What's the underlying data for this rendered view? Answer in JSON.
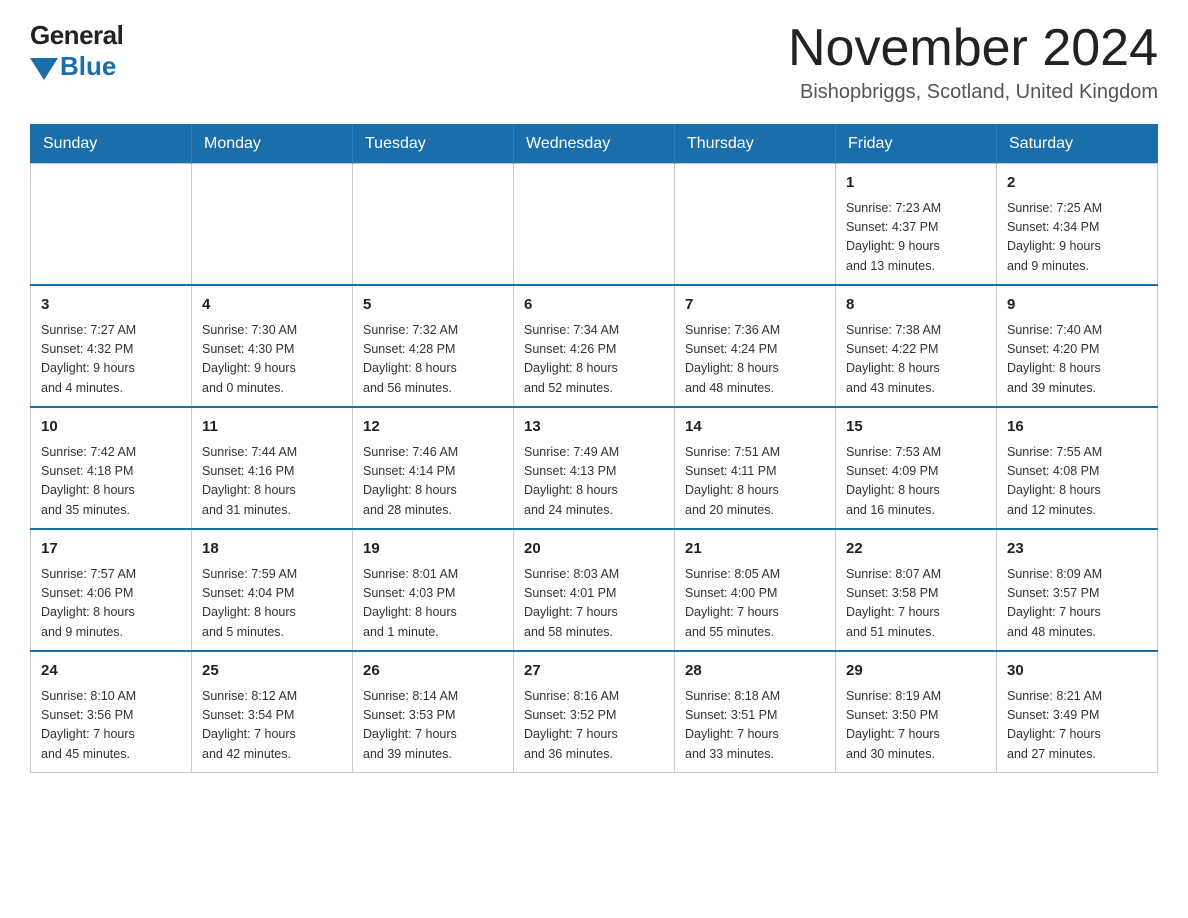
{
  "logo": {
    "general": "General",
    "blue": "Blue"
  },
  "title": "November 2024",
  "location": "Bishopbriggs, Scotland, United Kingdom",
  "weekdays": [
    "Sunday",
    "Monday",
    "Tuesday",
    "Wednesday",
    "Thursday",
    "Friday",
    "Saturday"
  ],
  "weeks": [
    [
      {
        "day": "",
        "info": ""
      },
      {
        "day": "",
        "info": ""
      },
      {
        "day": "",
        "info": ""
      },
      {
        "day": "",
        "info": ""
      },
      {
        "day": "",
        "info": ""
      },
      {
        "day": "1",
        "info": "Sunrise: 7:23 AM\nSunset: 4:37 PM\nDaylight: 9 hours\nand 13 minutes."
      },
      {
        "day": "2",
        "info": "Sunrise: 7:25 AM\nSunset: 4:34 PM\nDaylight: 9 hours\nand 9 minutes."
      }
    ],
    [
      {
        "day": "3",
        "info": "Sunrise: 7:27 AM\nSunset: 4:32 PM\nDaylight: 9 hours\nand 4 minutes."
      },
      {
        "day": "4",
        "info": "Sunrise: 7:30 AM\nSunset: 4:30 PM\nDaylight: 9 hours\nand 0 minutes."
      },
      {
        "day": "5",
        "info": "Sunrise: 7:32 AM\nSunset: 4:28 PM\nDaylight: 8 hours\nand 56 minutes."
      },
      {
        "day": "6",
        "info": "Sunrise: 7:34 AM\nSunset: 4:26 PM\nDaylight: 8 hours\nand 52 minutes."
      },
      {
        "day": "7",
        "info": "Sunrise: 7:36 AM\nSunset: 4:24 PM\nDaylight: 8 hours\nand 48 minutes."
      },
      {
        "day": "8",
        "info": "Sunrise: 7:38 AM\nSunset: 4:22 PM\nDaylight: 8 hours\nand 43 minutes."
      },
      {
        "day": "9",
        "info": "Sunrise: 7:40 AM\nSunset: 4:20 PM\nDaylight: 8 hours\nand 39 minutes."
      }
    ],
    [
      {
        "day": "10",
        "info": "Sunrise: 7:42 AM\nSunset: 4:18 PM\nDaylight: 8 hours\nand 35 minutes."
      },
      {
        "day": "11",
        "info": "Sunrise: 7:44 AM\nSunset: 4:16 PM\nDaylight: 8 hours\nand 31 minutes."
      },
      {
        "day": "12",
        "info": "Sunrise: 7:46 AM\nSunset: 4:14 PM\nDaylight: 8 hours\nand 28 minutes."
      },
      {
        "day": "13",
        "info": "Sunrise: 7:49 AM\nSunset: 4:13 PM\nDaylight: 8 hours\nand 24 minutes."
      },
      {
        "day": "14",
        "info": "Sunrise: 7:51 AM\nSunset: 4:11 PM\nDaylight: 8 hours\nand 20 minutes."
      },
      {
        "day": "15",
        "info": "Sunrise: 7:53 AM\nSunset: 4:09 PM\nDaylight: 8 hours\nand 16 minutes."
      },
      {
        "day": "16",
        "info": "Sunrise: 7:55 AM\nSunset: 4:08 PM\nDaylight: 8 hours\nand 12 minutes."
      }
    ],
    [
      {
        "day": "17",
        "info": "Sunrise: 7:57 AM\nSunset: 4:06 PM\nDaylight: 8 hours\nand 9 minutes."
      },
      {
        "day": "18",
        "info": "Sunrise: 7:59 AM\nSunset: 4:04 PM\nDaylight: 8 hours\nand 5 minutes."
      },
      {
        "day": "19",
        "info": "Sunrise: 8:01 AM\nSunset: 4:03 PM\nDaylight: 8 hours\nand 1 minute."
      },
      {
        "day": "20",
        "info": "Sunrise: 8:03 AM\nSunset: 4:01 PM\nDaylight: 7 hours\nand 58 minutes."
      },
      {
        "day": "21",
        "info": "Sunrise: 8:05 AM\nSunset: 4:00 PM\nDaylight: 7 hours\nand 55 minutes."
      },
      {
        "day": "22",
        "info": "Sunrise: 8:07 AM\nSunset: 3:58 PM\nDaylight: 7 hours\nand 51 minutes."
      },
      {
        "day": "23",
        "info": "Sunrise: 8:09 AM\nSunset: 3:57 PM\nDaylight: 7 hours\nand 48 minutes."
      }
    ],
    [
      {
        "day": "24",
        "info": "Sunrise: 8:10 AM\nSunset: 3:56 PM\nDaylight: 7 hours\nand 45 minutes."
      },
      {
        "day": "25",
        "info": "Sunrise: 8:12 AM\nSunset: 3:54 PM\nDaylight: 7 hours\nand 42 minutes."
      },
      {
        "day": "26",
        "info": "Sunrise: 8:14 AM\nSunset: 3:53 PM\nDaylight: 7 hours\nand 39 minutes."
      },
      {
        "day": "27",
        "info": "Sunrise: 8:16 AM\nSunset: 3:52 PM\nDaylight: 7 hours\nand 36 minutes."
      },
      {
        "day": "28",
        "info": "Sunrise: 8:18 AM\nSunset: 3:51 PM\nDaylight: 7 hours\nand 33 minutes."
      },
      {
        "day": "29",
        "info": "Sunrise: 8:19 AM\nSunset: 3:50 PM\nDaylight: 7 hours\nand 30 minutes."
      },
      {
        "day": "30",
        "info": "Sunrise: 8:21 AM\nSunset: 3:49 PM\nDaylight: 7 hours\nand 27 minutes."
      }
    ]
  ]
}
